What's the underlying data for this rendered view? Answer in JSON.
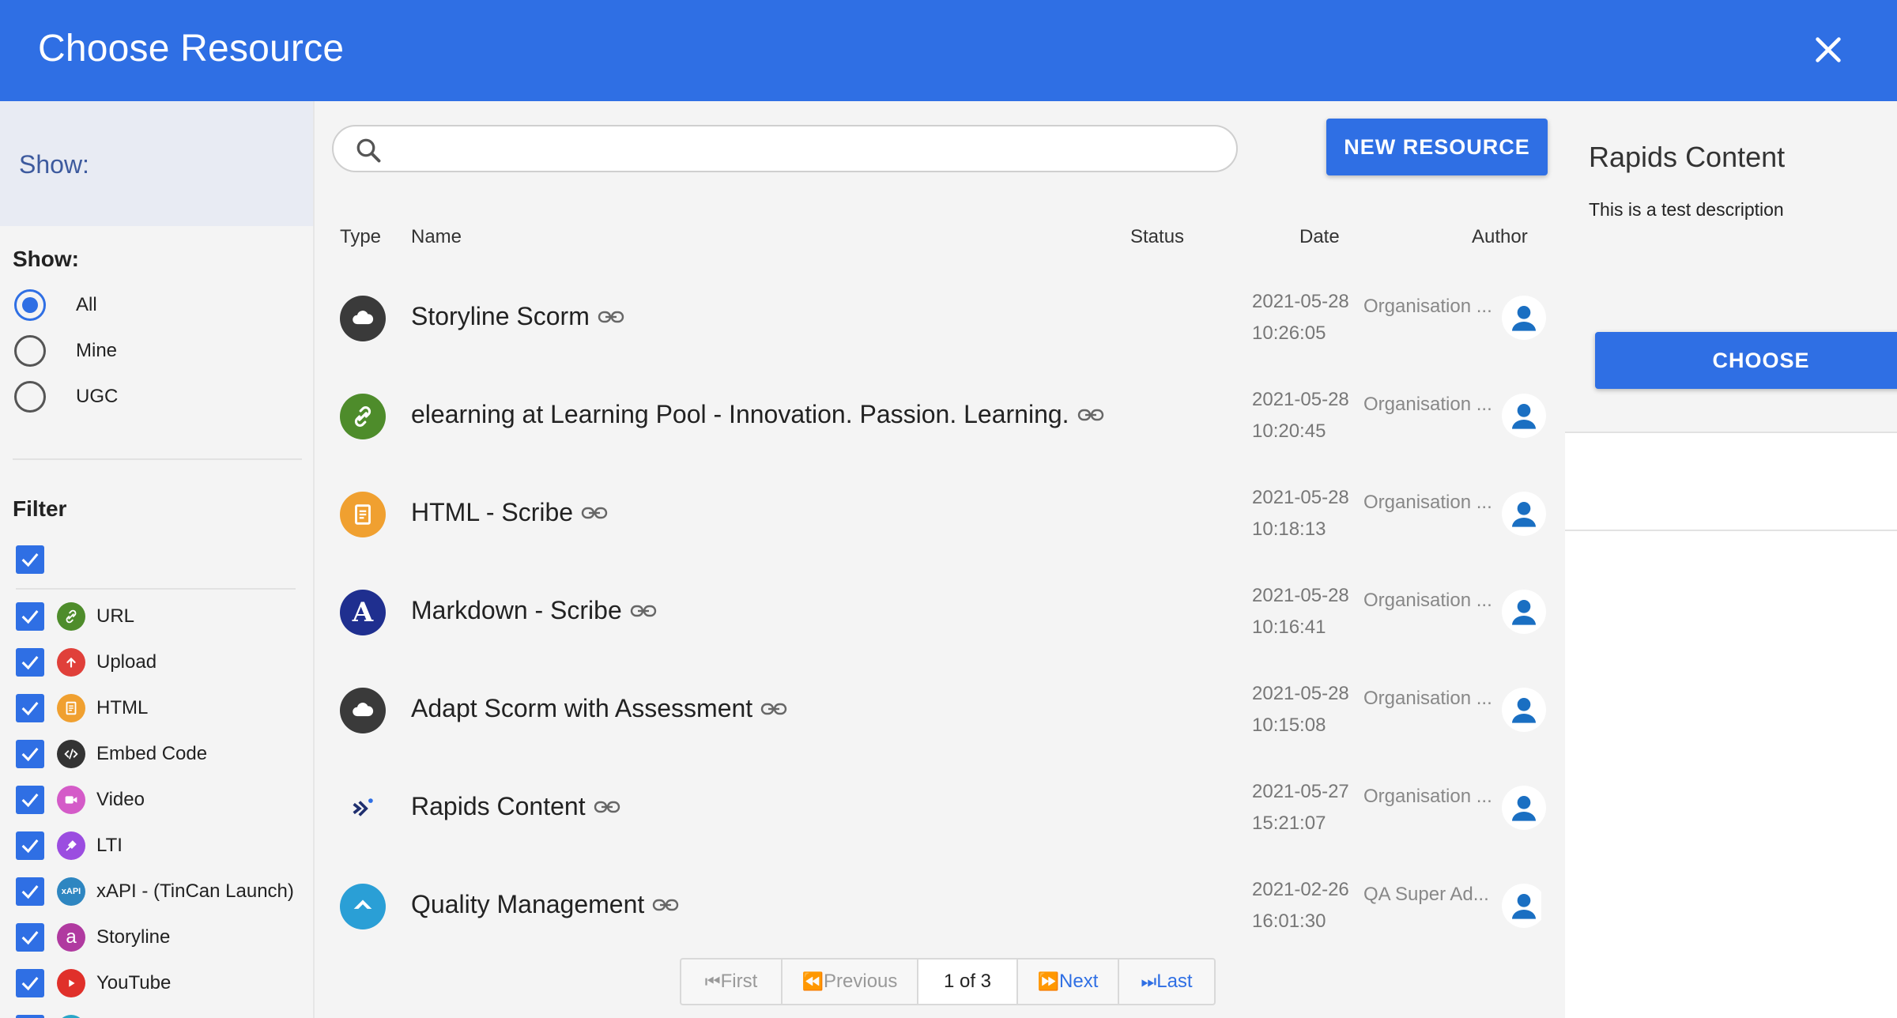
{
  "header": {
    "title": "Choose Resource"
  },
  "sidebar": {
    "top_label": "Show:",
    "show_label": "Show:",
    "show_options": [
      {
        "label": "All",
        "checked": true
      },
      {
        "label": "Mine",
        "checked": false
      },
      {
        "label": "UGC",
        "checked": false
      }
    ],
    "filter_label": "Filter",
    "filters": [
      {
        "label": "URL",
        "icon": "link-icon",
        "color": "#4e8c2b"
      },
      {
        "label": "Upload",
        "icon": "upload-icon",
        "color": "#e0403a"
      },
      {
        "label": "HTML",
        "icon": "document-icon",
        "color": "#f0a030"
      },
      {
        "label": "Embed Code",
        "icon": "code-icon",
        "color": "#333333"
      },
      {
        "label": "Video",
        "icon": "video-icon",
        "color": "#d45bc8"
      },
      {
        "label": "LTI",
        "icon": "plug-icon",
        "color": "#9b4de0"
      },
      {
        "label": "xAPI - (TinCan Launch)",
        "icon": "xapi-icon",
        "icon_text": "xAPI",
        "color": "#2e86c1"
      },
      {
        "label": "Storyline",
        "icon": "storyline-icon",
        "icon_text": "a",
        "color": "#b03aa0"
      },
      {
        "label": "YouTube",
        "icon": "youtube-icon",
        "color": "#e0302a"
      }
    ]
  },
  "main": {
    "search": {
      "placeholder": "",
      "value": ""
    },
    "new_resource_label": "NEW RESOURCE",
    "columns": {
      "type": "Type",
      "name": "Name",
      "status": "Status",
      "date": "Date",
      "author": "Author"
    },
    "rows": [
      {
        "name": "Storyline Scorm",
        "date": "2021-05-28",
        "time": "10:26:05",
        "author": "Organisation ...",
        "icon": "cloud-icon"
      },
      {
        "name": "elearning at Learning Pool - Innovation. Passion. Learning.",
        "date": "2021-05-28",
        "time": "10:20:45",
        "author": "Organisation ...",
        "icon": "link-icon"
      },
      {
        "name": "HTML - Scribe",
        "date": "2021-05-28",
        "time": "10:18:13",
        "author": "Organisation ...",
        "icon": "document-icon"
      },
      {
        "name": "Markdown - Scribe",
        "date": "2021-05-28",
        "time": "10:16:41",
        "author": "Organisation ...",
        "icon": "markdown-icon",
        "icon_text": "A"
      },
      {
        "name": "Adapt Scorm with Assessment",
        "date": "2021-05-28",
        "time": "10:15:08",
        "author": "Organisation ...",
        "icon": "cloud-icon"
      },
      {
        "name": "Rapids Content",
        "date": "2021-05-27",
        "time": "15:21:07",
        "author": "Organisation ...",
        "icon": "rapids-icon"
      },
      {
        "name": "Quality Management",
        "date": "2021-02-26",
        "time": "16:01:30",
        "author": "QA Super Ad...",
        "icon": "quality-icon"
      }
    ],
    "pagination": {
      "first": "First",
      "previous": "Previous",
      "current": "1 of 3",
      "next": "Next",
      "last": "Last"
    }
  },
  "detail": {
    "title": "Rapids Content",
    "description": "This is a test description",
    "choose_label": "CHOOSE"
  },
  "colors": {
    "primary": "#2f6fe4"
  }
}
